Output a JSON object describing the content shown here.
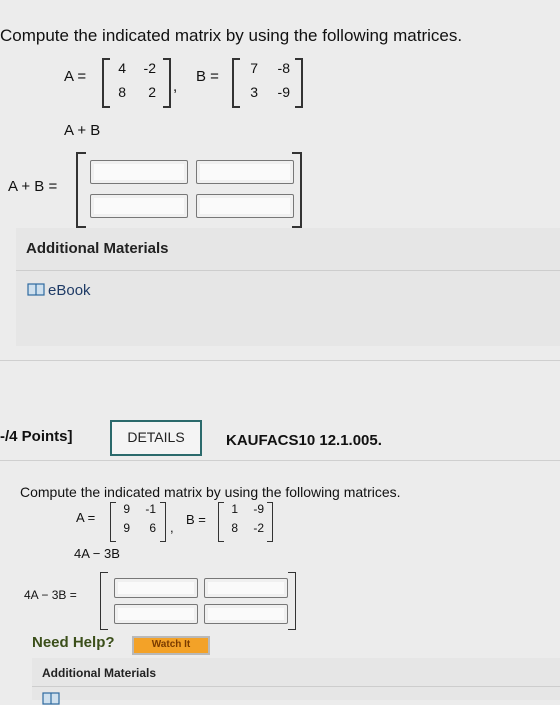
{
  "q1": {
    "prompt": "Compute the indicated matrix by using the following matrices.",
    "A_label": "A =",
    "A": [
      "4",
      "-2",
      "8",
      "2"
    ],
    "B_label": "B =",
    "B": [
      "7",
      "-8",
      "3",
      "-9"
    ],
    "expression": "A + B",
    "answer_label": "A + B ="
  },
  "additional": {
    "heading": "Additional Materials",
    "ebook": "eBook"
  },
  "q2": {
    "points": "-/4 Points]",
    "details": "DETAILS",
    "code": "KAUFACS10 12.1.005.",
    "prompt": "Compute the indicated matrix by using the following matrices.",
    "A_label": "A =",
    "A": [
      "9",
      "-1",
      "9",
      "6"
    ],
    "B_label": "B =",
    "B": [
      "1",
      "-9",
      "8",
      "-2"
    ],
    "expression": "4A − 3B",
    "answer_label": "4A − 3B =",
    "need_help": "Need Help?",
    "watch": "Watch It",
    "additional": "Additional Materials"
  }
}
